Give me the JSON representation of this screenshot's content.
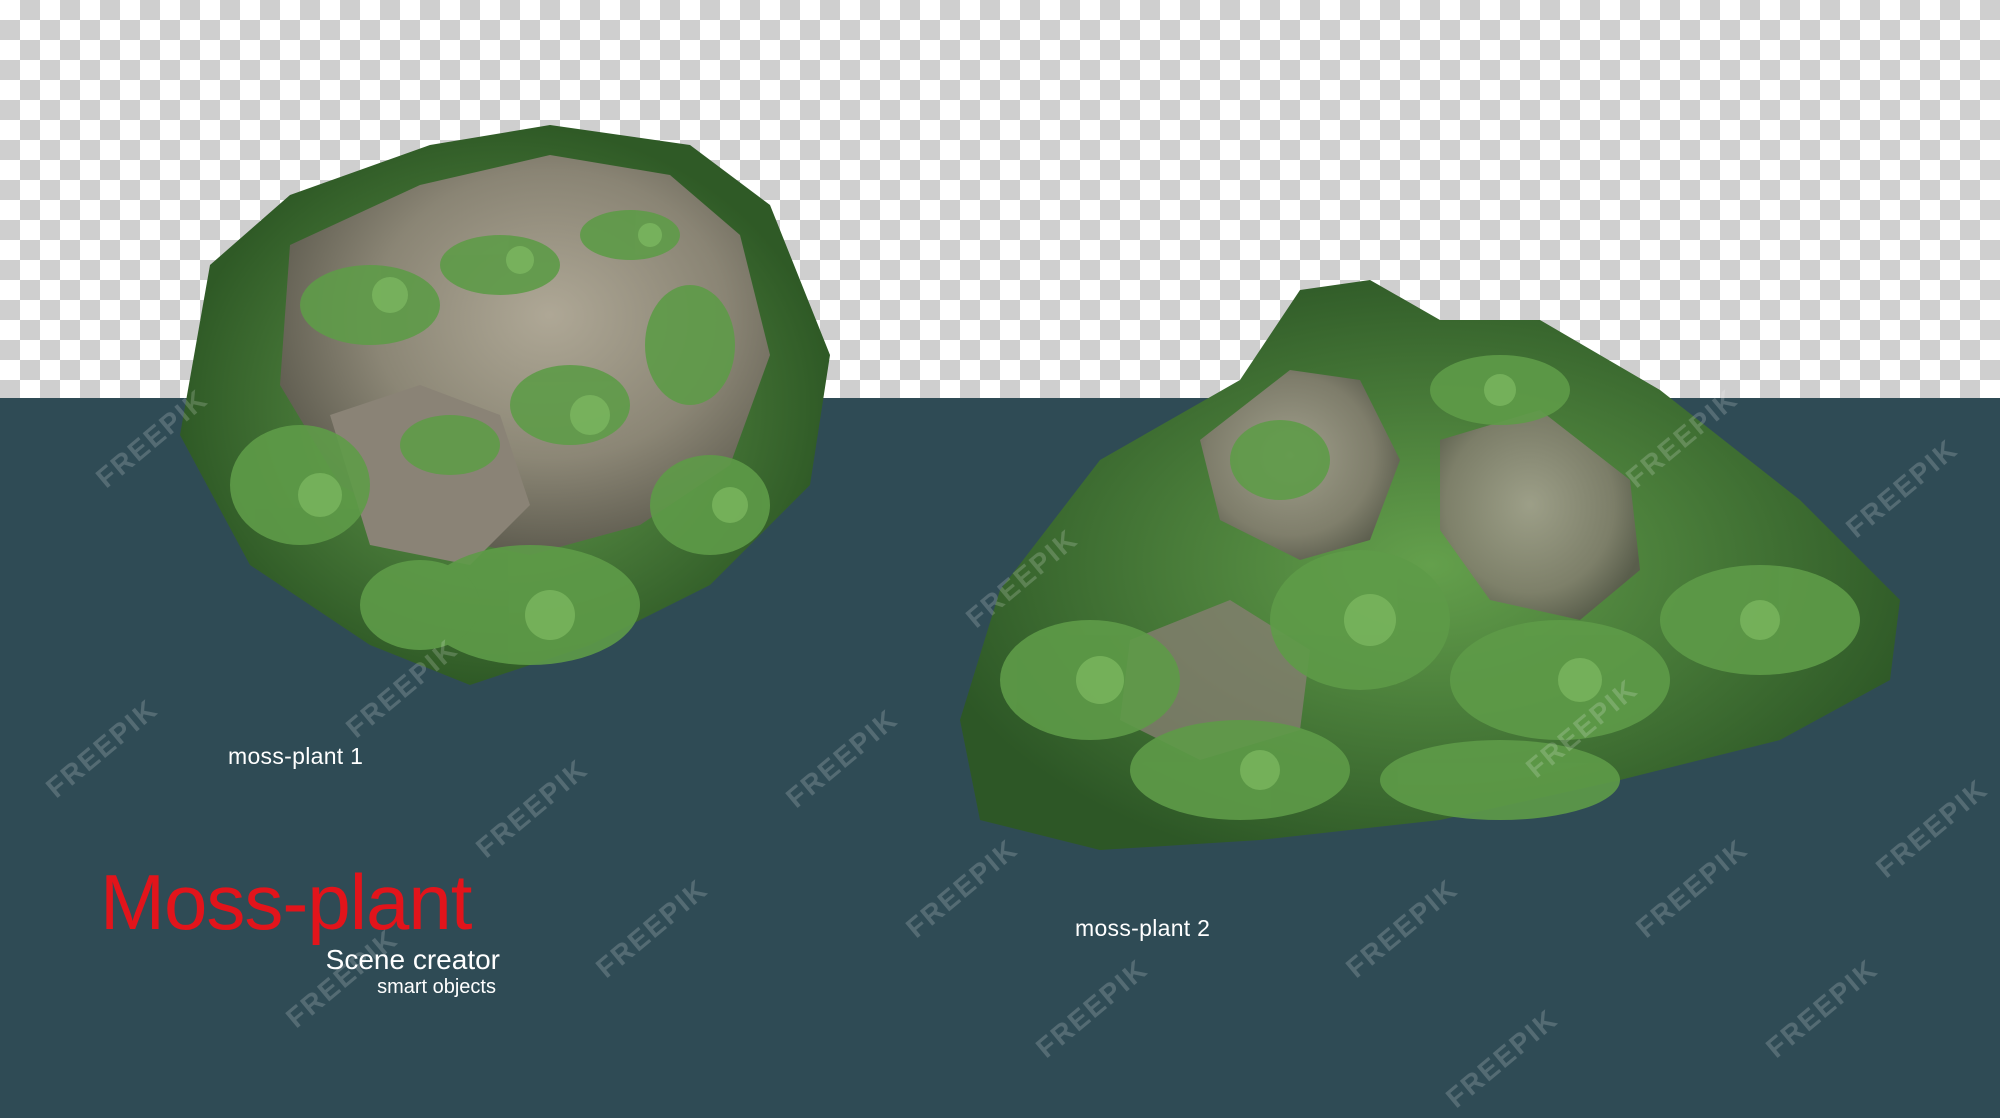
{
  "labels": {
    "plant1": "moss-plant 1",
    "plant2": "moss-plant 2",
    "title": "Moss-plant",
    "subtitle": "Scene creator",
    "subtitle2": "smart objects"
  },
  "watermark": {
    "text": "FREEPIK"
  },
  "colors": {
    "title_red": "#e2141b",
    "background_teal": "#2f4b55",
    "moss_green": "#4f8a3e",
    "rock_grey": "#9a948a"
  }
}
